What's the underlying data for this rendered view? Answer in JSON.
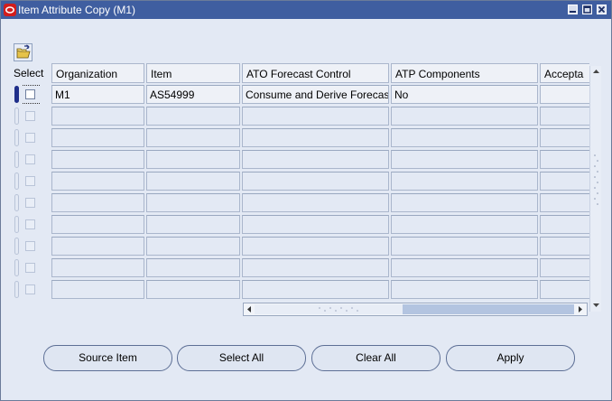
{
  "window": {
    "title": "Item Attribute Copy (M1)"
  },
  "table": {
    "select_label": "Select",
    "columns": [
      "Organization",
      "Item",
      "ATO Forecast Control",
      "ATP Components",
      "Accepta"
    ],
    "rows": [
      {
        "selected": false,
        "cells": [
          "M1",
          "AS54999",
          "Consume and Derive Forecast",
          "No",
          ""
        ]
      },
      {
        "selected": false,
        "cells": [
          "",
          "",
          "",
          "",
          ""
        ]
      },
      {
        "selected": false,
        "cells": [
          "",
          "",
          "",
          "",
          ""
        ]
      },
      {
        "selected": false,
        "cells": [
          "",
          "",
          "",
          "",
          ""
        ]
      },
      {
        "selected": false,
        "cells": [
          "",
          "",
          "",
          "",
          ""
        ]
      },
      {
        "selected": false,
        "cells": [
          "",
          "",
          "",
          "",
          ""
        ]
      },
      {
        "selected": false,
        "cells": [
          "",
          "",
          "",
          "",
          ""
        ]
      },
      {
        "selected": false,
        "cells": [
          "",
          "",
          "",
          "",
          ""
        ]
      },
      {
        "selected": false,
        "cells": [
          "",
          "",
          "",
          "",
          ""
        ]
      },
      {
        "selected": false,
        "cells": [
          "",
          "",
          "",
          "",
          ""
        ]
      }
    ]
  },
  "buttons": {
    "source_item": "Source Item",
    "select_all": "Select All",
    "clear_all": "Clear All",
    "apply": "Apply"
  },
  "icons": {
    "app": "oracle-icon",
    "open": "open-folder-icon"
  }
}
